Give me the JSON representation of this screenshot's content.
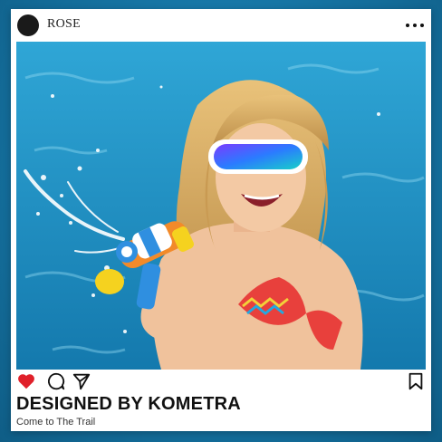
{
  "post": {
    "username": "ROSE",
    "title": "DESIGNED BY KOMETRA",
    "subtitle": "Come to The Trail",
    "liked": true
  },
  "icons": {
    "avatar": "avatar-circle",
    "more": "more-dots-icon",
    "like": "heart-icon",
    "comment": "comment-icon",
    "share": "send-icon",
    "save": "bookmark-icon"
  },
  "colors": {
    "accent_like": "#e0202a",
    "pool": "#1f8ec4",
    "card": "#ffffff"
  }
}
